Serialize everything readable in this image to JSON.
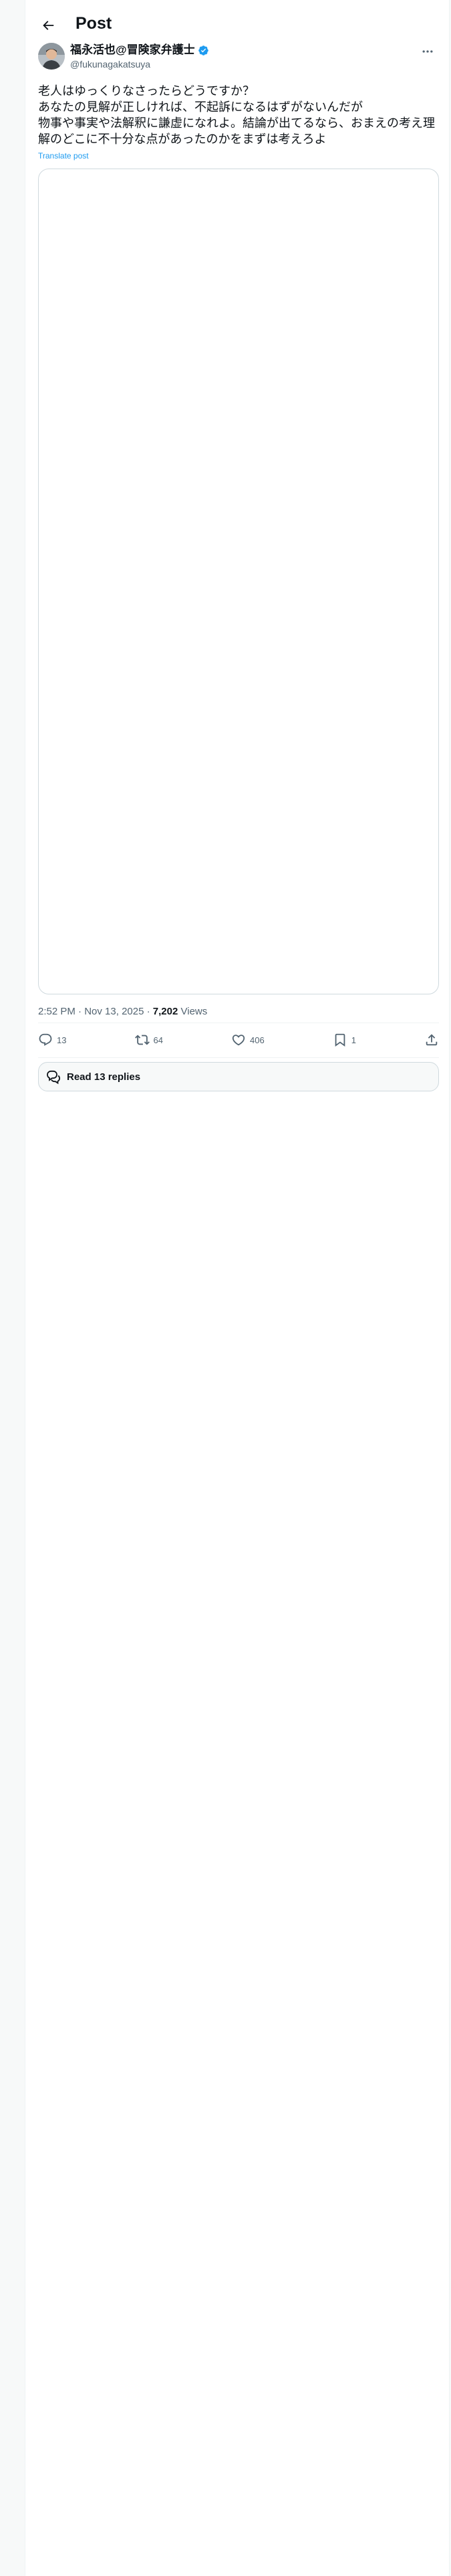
{
  "header": {
    "title": "Post",
    "back_icon": "arrow-left-icon"
  },
  "author": {
    "name": "福永活也@冒険家弁護士",
    "handle": "@fukunagakatsuya",
    "verified_color": "#1d9bf0"
  },
  "post": {
    "text": "老人はゆっくりなさったらどうですか？\nあなたの見解が正しければ、不起訴になるはずがないんだが\n物事や事実や法解釈に謙虚になれよ。結論が出てるなら、おまえの考え理解のどこに不十分な点があったのかをまずは考えろよ",
    "translate_label": "Translate post",
    "time": "2:52 PM",
    "date": "Nov 13, 2025",
    "views_count": "7,202",
    "views_label": "Views"
  },
  "actions": {
    "replies": "13",
    "reposts": "64",
    "likes": "406",
    "bookmarks": "1"
  },
  "read_replies": {
    "label": "Read 13 replies"
  },
  "colors": {
    "accent": "#1d9bf0",
    "text": "#0f1419",
    "secondary": "#536471",
    "border": "#cfd9de"
  }
}
